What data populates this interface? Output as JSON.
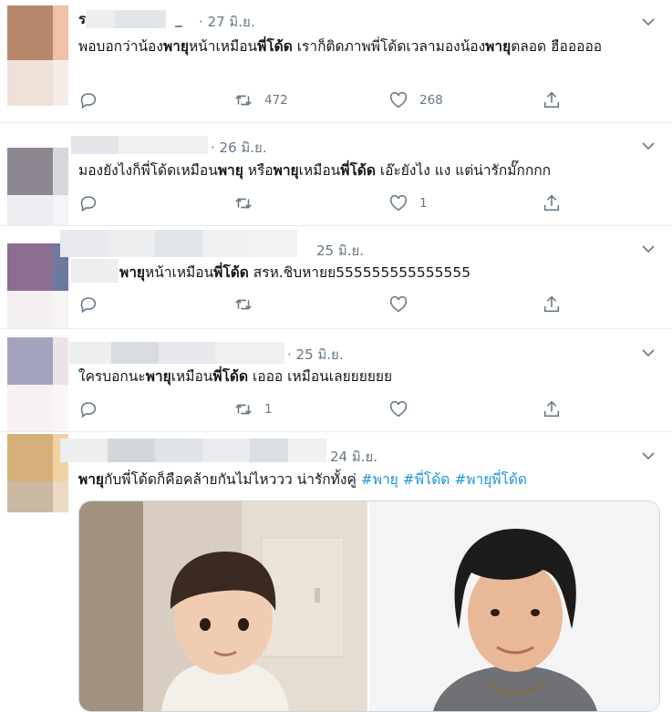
{
  "tweets": [
    {
      "name_visible": "ร",
      "name_suffix": "_",
      "date": "· 27 มิ.ย.",
      "text_parts": [
        {
          "t": "พอบอกว่าน้อง",
          "b": false
        },
        {
          "t": "พายุ",
          "b": true
        },
        {
          "t": "หน้าเหมือน",
          "b": false
        },
        {
          "t": "พี่โด้ด",
          "b": true
        },
        {
          "t": " เราก็ติดภาพพี่โด้ดเวลามองน้อง",
          "b": false
        },
        {
          "t": "พายุ",
          "b": true
        },
        {
          "t": "ตลอด ฮือออออ",
          "b": false
        }
      ],
      "retweets": "472",
      "likes": "268",
      "avatar_colors": [
        "#b6876b",
        "#f2c0a8"
      ]
    },
    {
      "date": "· 26 มิ.ย.",
      "text_parts": [
        {
          "t": "มองยังไงก็พี่โด้ดเหมือน",
          "b": false
        },
        {
          "t": "พายุ",
          "b": true
        },
        {
          "t": " หรือ",
          "b": false
        },
        {
          "t": "พายุ",
          "b": true
        },
        {
          "t": "เหมือน",
          "b": false
        },
        {
          "t": "พี่โด้ด",
          "b": true
        },
        {
          "t": " เอ๊ะยังไง แง แต่น่ารักมั๊กกกก",
          "b": false
        }
      ],
      "retweets": "",
      "likes": "1",
      "avatar_colors": [
        "#8d8792",
        "#d6d6dc"
      ]
    },
    {
      "date": "25 มิ.ย.",
      "text_parts": [
        {
          "t": "พายุ",
          "b": true
        },
        {
          "t": "หน้าเหมือน",
          "b": false
        },
        {
          "t": "พี่โด้ด",
          "b": true
        },
        {
          "t": " สรห.ชิบหายย555555555555555",
          "b": false
        }
      ],
      "retweets": "",
      "likes": "",
      "avatar_colors": [
        "#8b6f8e",
        "#6d7aa0"
      ]
    },
    {
      "date": "· 25 มิ.ย.",
      "text_parts": [
        {
          "t": "ใครบอกนะ",
          "b": false
        },
        {
          "t": "พายุ",
          "b": true
        },
        {
          "t": "เหมือน",
          "b": false
        },
        {
          "t": "พี่โด้ด",
          "b": true
        },
        {
          "t": " เอออ เหมือนเลยยยยยย",
          "b": false
        }
      ],
      "retweets": "1",
      "likes": "",
      "avatar_colors": [
        "#a5a4c0",
        "#ece3e8"
      ]
    },
    {
      "date": "24 มิ.ย.",
      "text_parts": [
        {
          "t": "พายุ",
          "b": true
        },
        {
          "t": "กับพี่โด้ดก็คือคล้ายกันไม่ไหววว น่ารักทั้งคู่ ",
          "b": false
        },
        {
          "t": "#พายุ",
          "b": false,
          "tag": true
        },
        {
          "t": " ",
          "b": false
        },
        {
          "t": "#พี่โด้ด",
          "b": false,
          "tag": true
        },
        {
          "t": " ",
          "b": false
        },
        {
          "t": "#พายุพี่โด้ด",
          "b": false,
          "tag": true
        }
      ],
      "avatar_colors": [
        "#d5b07a",
        "#c9b9a3"
      ]
    }
  ]
}
